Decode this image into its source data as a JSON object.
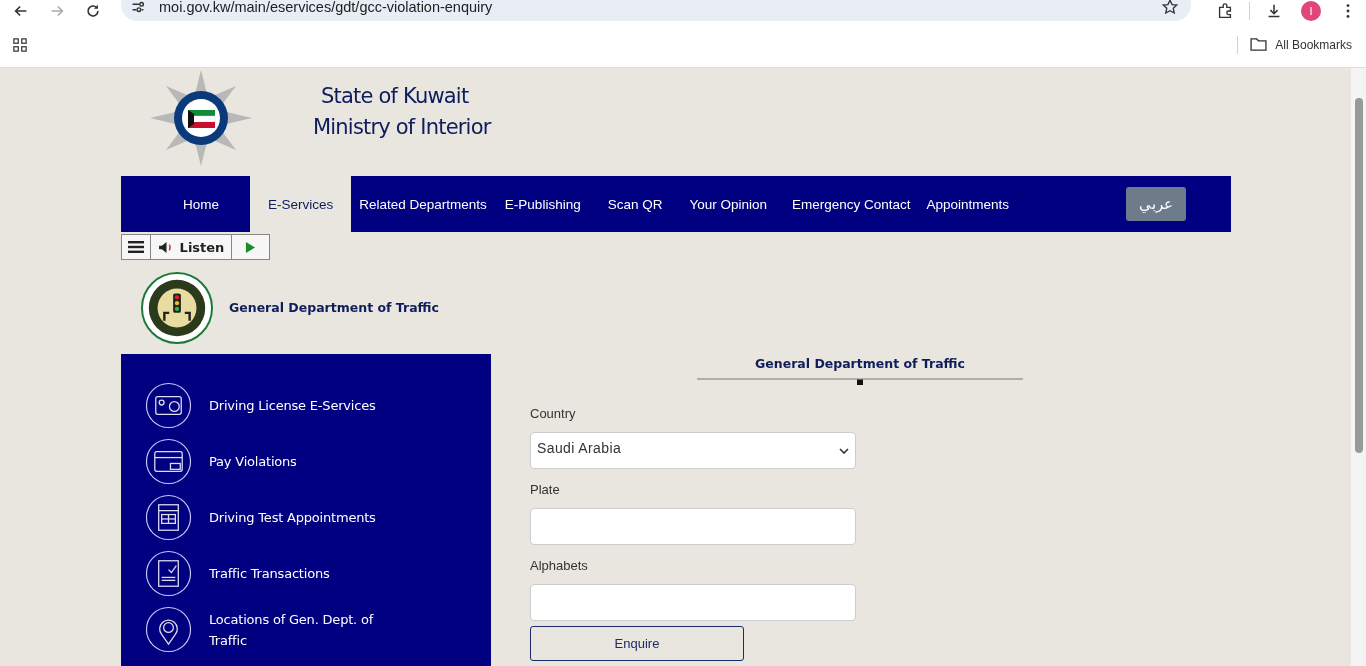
{
  "browser": {
    "url": "moi.gov.kw/main/eservices/gdt/gcc-violation-enquiry",
    "profile_initial": "I",
    "bookmarks_label": "All Bookmarks"
  },
  "header": {
    "title_line1": "State of Kuwait",
    "title_line2": "Ministry of Interior"
  },
  "nav": {
    "items": [
      {
        "label": "Home",
        "selected": false
      },
      {
        "label": "E-Services",
        "selected": true
      },
      {
        "label": "Related Departments",
        "selected": false
      },
      {
        "label": "E-Publishing",
        "selected": false
      },
      {
        "label": "Scan QR",
        "selected": false
      },
      {
        "label": "Your Opinion",
        "selected": false
      },
      {
        "label": "Emergency Contact",
        "selected": false
      },
      {
        "label": "Appointments",
        "selected": false
      }
    ],
    "language_button": "عربي"
  },
  "listen_bar": {
    "label": "Listen"
  },
  "department": {
    "title": "General Department of Traffic"
  },
  "sidebar": {
    "items": [
      {
        "label": "Driving License E-Services",
        "kind": "license"
      },
      {
        "label": "Pay Violations",
        "kind": "payment"
      },
      {
        "label": "Driving Test Appointments",
        "kind": "calendar"
      },
      {
        "label": "Traffic Transactions",
        "kind": "clipboard"
      },
      {
        "label": "Locations of Gen. Dept. of Traffic",
        "kind": "location"
      }
    ]
  },
  "form": {
    "heading": "General Department of Traffic",
    "fields": [
      {
        "label": "Country",
        "kind": "select",
        "value": "Saudi Arabia"
      },
      {
        "label": "Plate",
        "kind": "text"
      },
      {
        "label": "Alphabets",
        "kind": "text"
      }
    ],
    "submit": "Enquire"
  }
}
